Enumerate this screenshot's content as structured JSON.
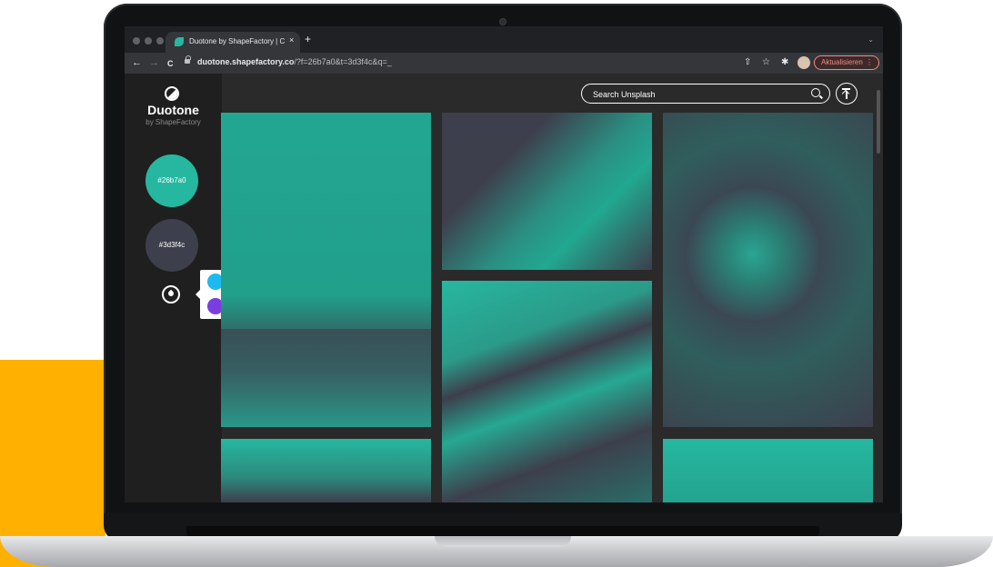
{
  "browser": {
    "tab_title": "Duotone by ShapeFactory | Cre",
    "tab_close": "×",
    "new_tab": "+",
    "tab_menu": "⌄",
    "url_domain": "duotone.shapefactory.co",
    "url_path": "/?f=26b7a0&t=3d3f4c&q=_",
    "update_label": "Aktualisieren",
    "update_menu": "⋮",
    "back": "←",
    "forward": "→",
    "reload": "C",
    "share": "⇧",
    "bookmark": "☆",
    "extensions": "✱"
  },
  "app": {
    "title": "Duotone",
    "subtitle": "by ShapeFactory",
    "highlight_color_label": "#26b7a0",
    "shadow_color_label": "#3d3f4c",
    "highlight_color": "#26b7a0",
    "shadow_color": "#3d3f4c",
    "search_placeholder": "Search Unsplash"
  },
  "palette": {
    "swatches": [
      "#1eb9f0",
      "#e31c37",
      "#f7df0a",
      "#26b7a0",
      "#f3c6dc",
      "#f06b6b",
      "#7a3ee0",
      "#7f0f4b",
      "#9a6f4b",
      "#3d3f4c",
      "#0a5fb0",
      "#2b1f57"
    ]
  },
  "decor": {
    "accent_yellow": "#ffb000",
    "page_bg": "#2a2a2b",
    "sidebar_bg": "#1f1f20"
  }
}
